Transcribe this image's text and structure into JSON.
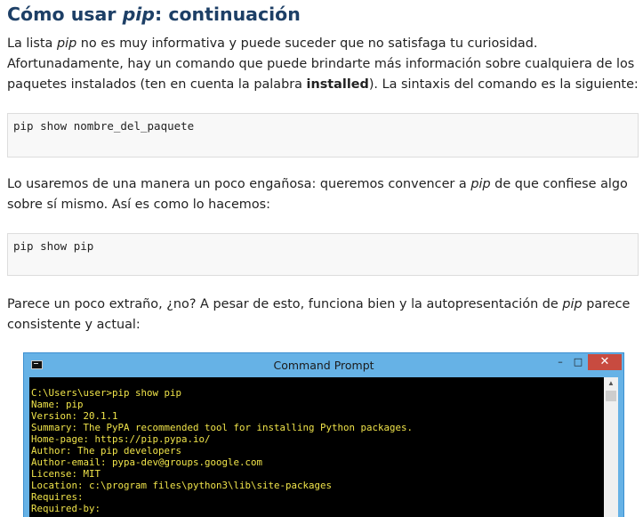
{
  "heading": {
    "prefix": "Cómo usar ",
    "em": "pip",
    "suffix": ": continuación"
  },
  "para1": {
    "t1": "La lista ",
    "em1": "pip",
    "t2": " no es muy informativa y puede suceder que no satisfaga tu curiosidad. Afortunadamente, hay un comando que puede brindarte más información sobre cualquiera de los paquetes instalados (ten en cuenta la palabra ",
    "strong1": "installed",
    "t3": "). La sintaxis del comando es la siguiente:"
  },
  "code1": "pip show nombre_del_paquete",
  "para2": {
    "t1": "Lo usaremos de una manera un poco engañosa: queremos convencer a ",
    "em1": "pip",
    "t2": " de que confiese algo sobre sí mismo. Así es como lo hacemos:"
  },
  "code2": "pip show pip",
  "para3": {
    "t1": "Parece un poco extraño, ¿no? A pesar de esto, funciona bien y la autopresentación de ",
    "em1": "pip",
    "t2": " parece consistente y actual:"
  },
  "window": {
    "title": "Command Prompt",
    "minimize": "–",
    "maximize": "□",
    "close": "✕",
    "scroll_up": "▲",
    "console_lines": [
      "C:\\Users\\user>pip show pip",
      "Name: pip",
      "Version: 20.1.1",
      "Summary: The PyPA recommended tool for installing Python packages.",
      "Home-page: https://pip.pypa.io/",
      "Author: The pip developers",
      "Author-email: pypa-dev@groups.google.com",
      "License: MIT",
      "Location: c:\\program files\\python3\\lib\\site-packages",
      "Requires:",
      "Required-by:"
    ]
  },
  "colors": {
    "heading": "#1d3f66",
    "console_bg": "#000000",
    "console_text": "#f0e44a",
    "titlebar": "#66b2e6",
    "close_button": "#c84b40"
  }
}
